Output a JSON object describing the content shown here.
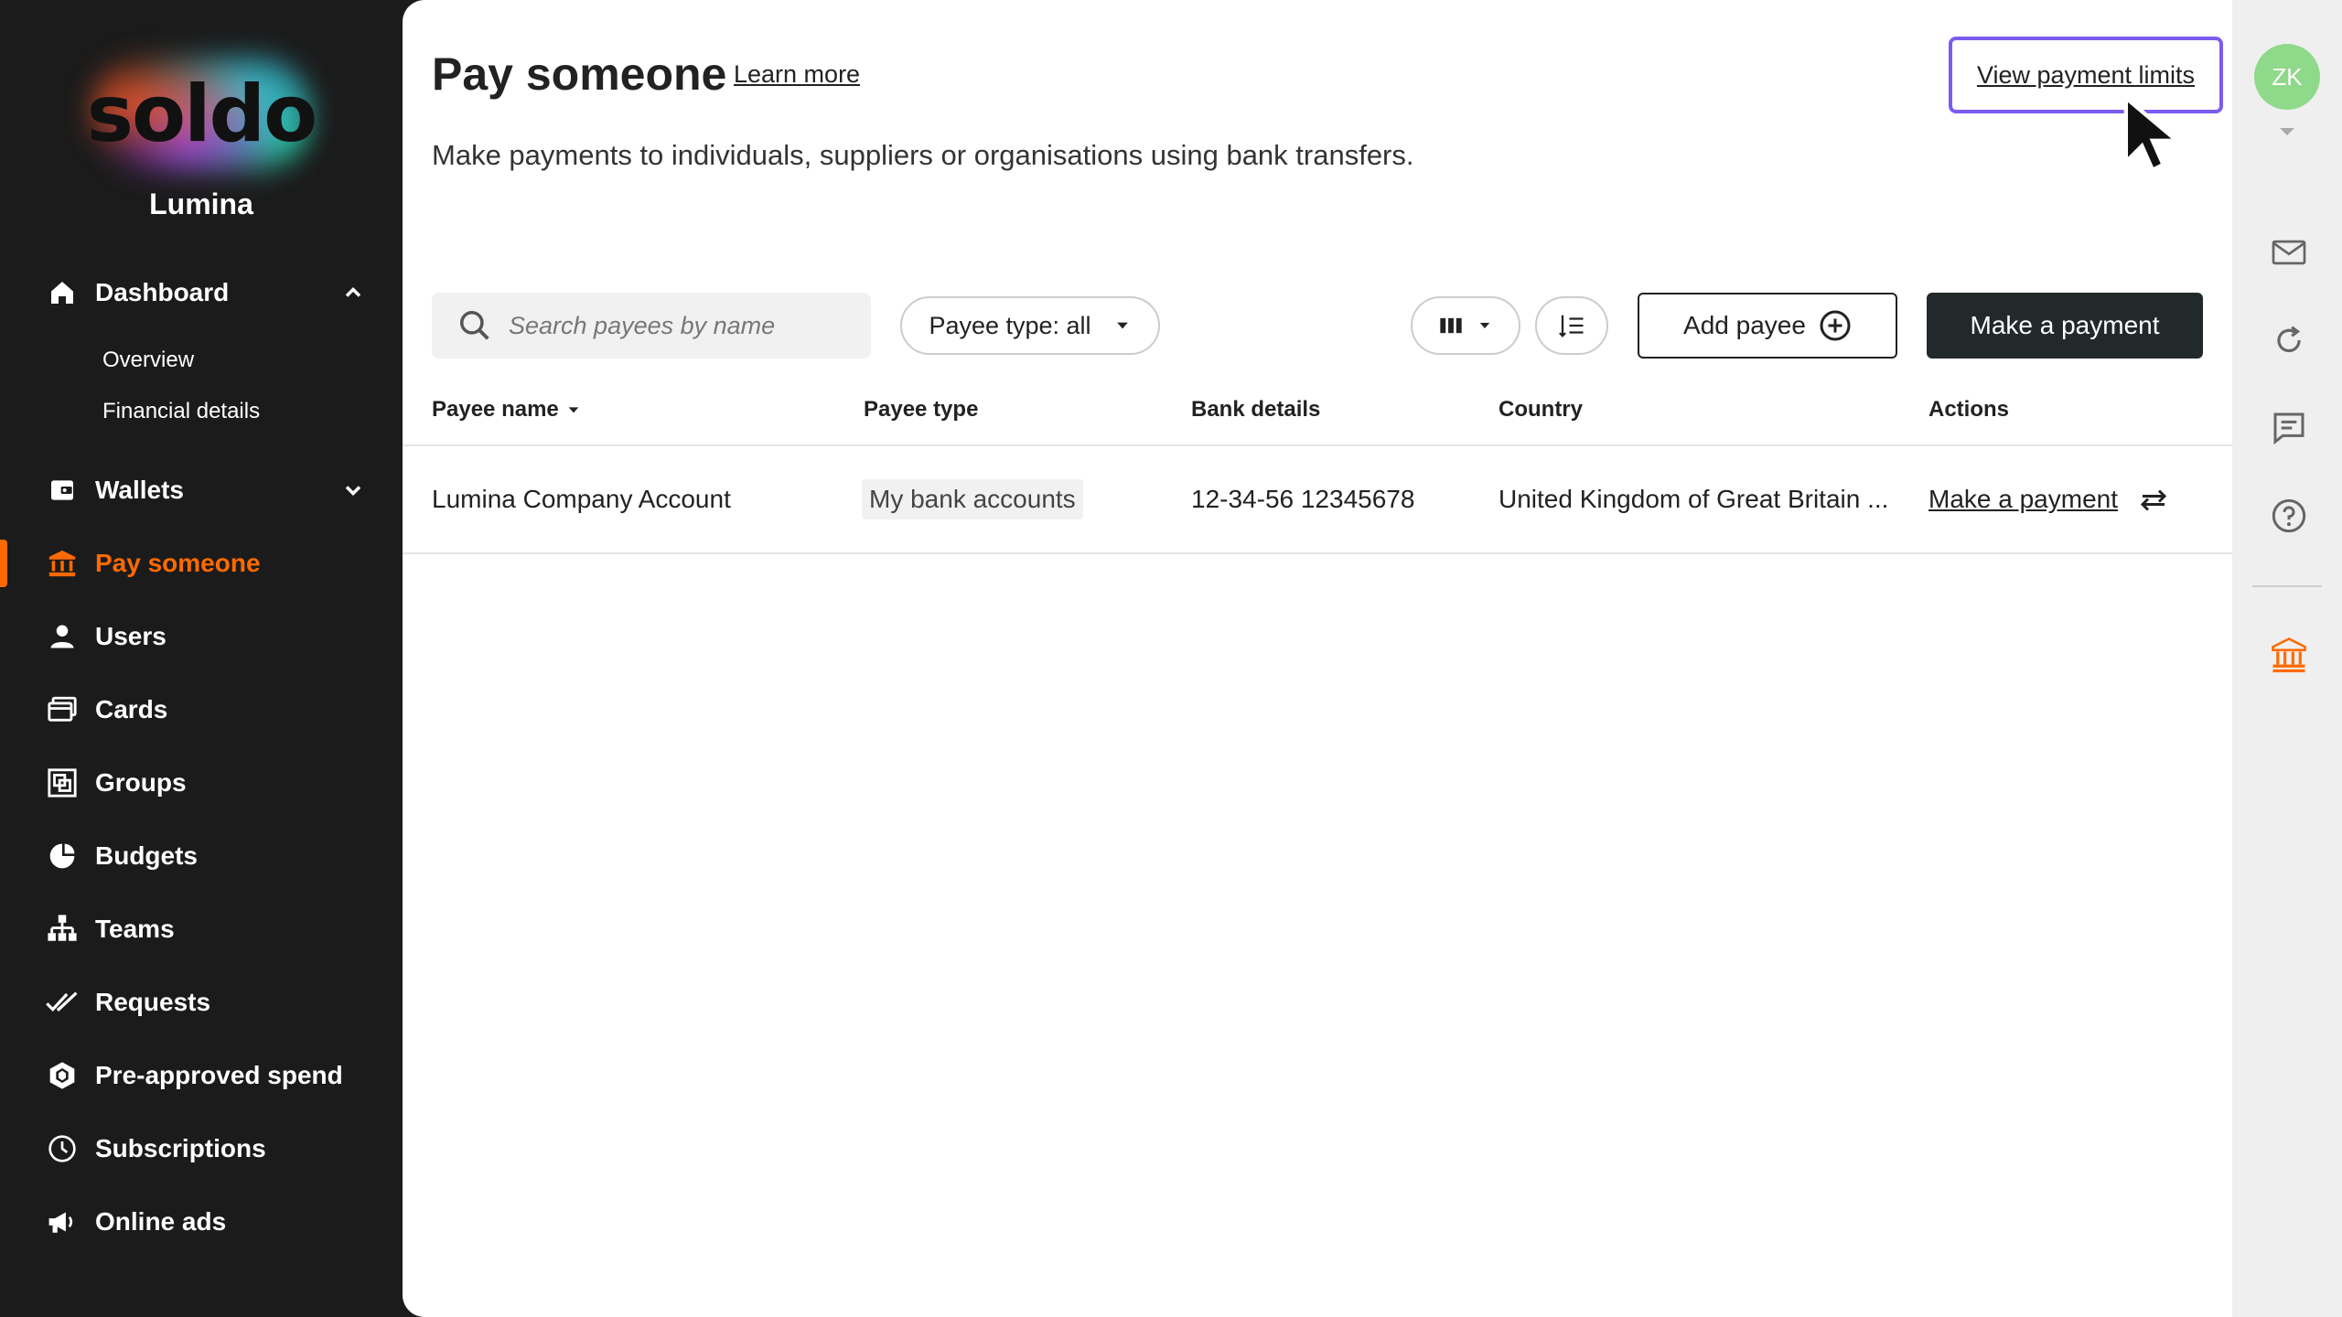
{
  "sidebar": {
    "logo_text": "soldo",
    "org_name": "Lumina",
    "items": [
      {
        "label": "Dashboard",
        "icon": "home-icon"
      },
      {
        "label": "Wallets",
        "icon": "wallet-icon"
      },
      {
        "label": "Pay someone",
        "icon": "bank-icon"
      },
      {
        "label": "Users",
        "icon": "user-icon"
      },
      {
        "label": "Cards",
        "icon": "card-icon"
      },
      {
        "label": "Groups",
        "icon": "groups-icon"
      },
      {
        "label": "Budgets",
        "icon": "budget-icon"
      },
      {
        "label": "Teams",
        "icon": "teams-icon"
      },
      {
        "label": "Requests",
        "icon": "checkmarks-icon"
      },
      {
        "label": "Pre-approved spend",
        "icon": "hexagon-icon"
      },
      {
        "label": "Subscriptions",
        "icon": "clock-icon"
      },
      {
        "label": "Online ads",
        "icon": "megaphone-icon"
      }
    ],
    "dashboard_sub": [
      "Overview",
      "Financial details"
    ],
    "active_color": "#ff6a00"
  },
  "header": {
    "title": "Pay someone",
    "learn_more": "Learn more",
    "view_limits": "View payment limits",
    "subtitle": "Make payments to individuals, suppliers or organisations using bank transfers."
  },
  "toolbar": {
    "search_placeholder": "Search payees by name",
    "payee_type_filter": "Payee type: all",
    "add_payee": "Add payee",
    "make_payment": "Make a payment"
  },
  "table": {
    "columns": [
      "Payee name",
      "Payee type",
      "Bank details",
      "Country",
      "Actions"
    ],
    "rows": [
      {
        "payee_name": "Lumina Company Account",
        "payee_type": "My bank accounts",
        "bank_details": "12-34-56 12345678",
        "country": "United Kingdom of Great Britain ...",
        "action": "Make a payment"
      }
    ]
  },
  "rail": {
    "avatar_initials": "ZK",
    "avatar_color": "#8fd98a"
  },
  "colors": {
    "focus_outline": "#7c5cf0",
    "primary_button": "#22292b"
  }
}
